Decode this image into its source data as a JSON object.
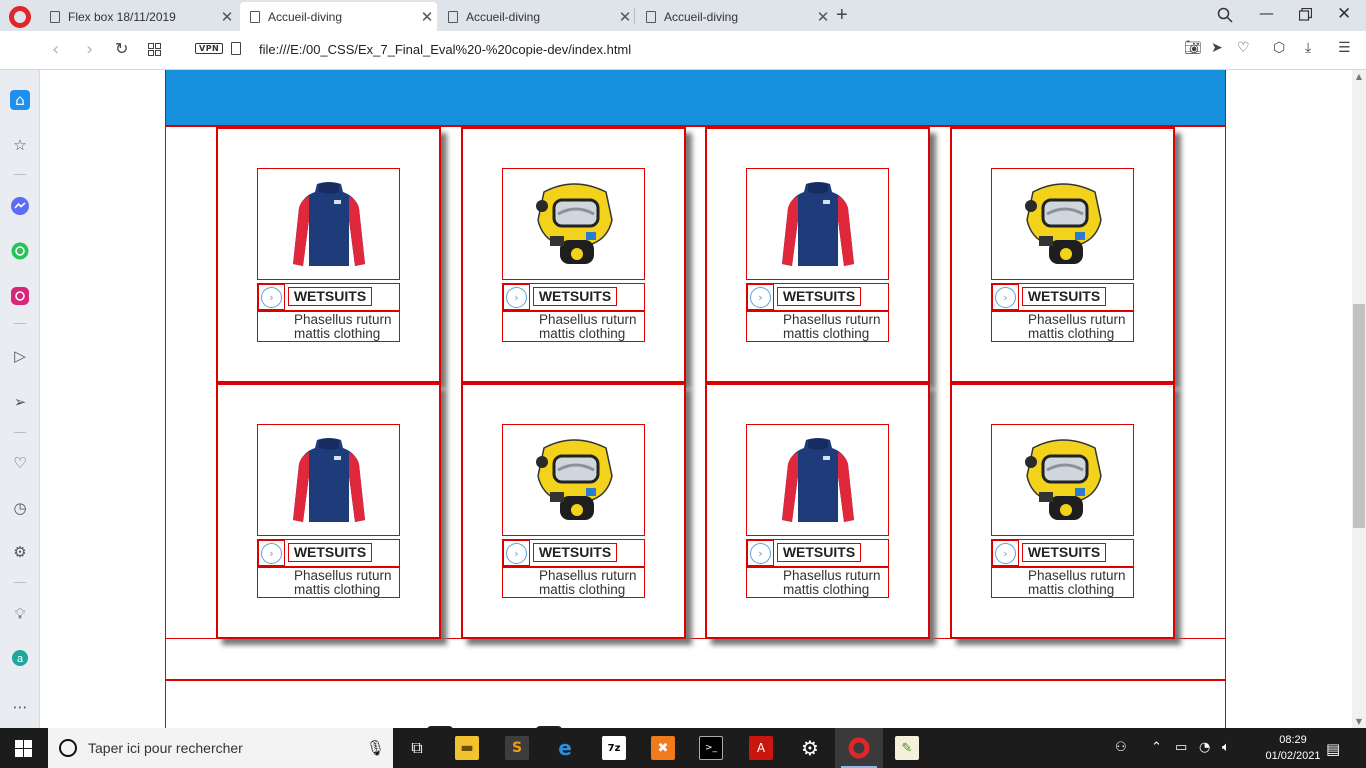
{
  "browser": {
    "tabs": [
      {
        "label": "Flex box 18/11/2019",
        "active": false
      },
      {
        "label": "Accueil-diving",
        "active": true
      },
      {
        "label": "Accueil-diving",
        "active": false
      },
      {
        "label": "Accueil-diving",
        "active": false
      }
    ],
    "new_tab_label": "+",
    "vpn_label": "VPN",
    "url": "file:///E:/00_CSS/Ex_7_Final_Eval%20-%20copie-dev/index.html"
  },
  "cards": [
    {
      "product": "wetsuit-jacket",
      "title": "WETSUITS",
      "desc_line1": "Phasellus ruturn",
      "desc_line2": "mattis clothing"
    },
    {
      "product": "diving-helmet",
      "title": "WETSUITS",
      "desc_line1": "Phasellus ruturn",
      "desc_line2": "mattis clothing"
    },
    {
      "product": "wetsuit-jacket",
      "title": "WETSUITS",
      "desc_line1": "Phasellus ruturn",
      "desc_line2": "mattis clothing"
    },
    {
      "product": "diving-helmet",
      "title": "WETSUITS",
      "desc_line1": "Phasellus ruturn",
      "desc_line2": "mattis clothing"
    },
    {
      "product": "wetsuit-jacket",
      "title": "WETSUITS",
      "desc_line1": "Phasellus ruturn",
      "desc_line2": "mattis clothing"
    },
    {
      "product": "diving-helmet",
      "title": "WETSUITS",
      "desc_line1": "Phasellus ruturn",
      "desc_line2": "mattis clothing"
    },
    {
      "product": "wetsuit-jacket",
      "title": "WETSUITS",
      "desc_line1": "Phasellus ruturn",
      "desc_line2": "mattis clothing"
    },
    {
      "product": "diving-helmet",
      "title": "WETSUITS",
      "desc_line1": "Phasellus ruturn",
      "desc_line2": "mattis clothing"
    }
  ],
  "taskbar": {
    "search_placeholder": "Taper ici pour rechercher",
    "time": "08:29",
    "date": "01/02/2021"
  },
  "colors": {
    "header_blue": "#1490dc",
    "border_red": "#dd0000",
    "opera_red": "#e0262d"
  }
}
